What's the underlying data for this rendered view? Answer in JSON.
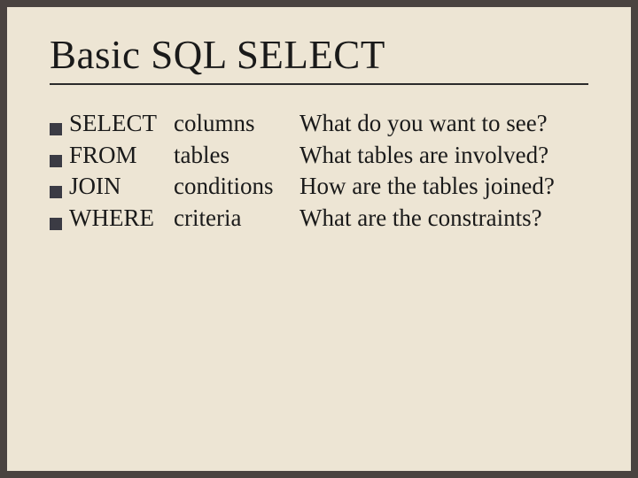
{
  "title": "Basic SQL SELECT",
  "rows": [
    {
      "keyword": "SELECT",
      "arg": "columns",
      "desc": "What do you want to see?"
    },
    {
      "keyword": "FROM",
      "arg": "tables",
      "desc": "What tables are involved?"
    },
    {
      "keyword": "JOIN",
      "arg": "conditions",
      "desc": "How are the tables joined?"
    },
    {
      "keyword": "WHERE",
      "arg": "criteria",
      "desc": "What are the constraints?"
    }
  ]
}
